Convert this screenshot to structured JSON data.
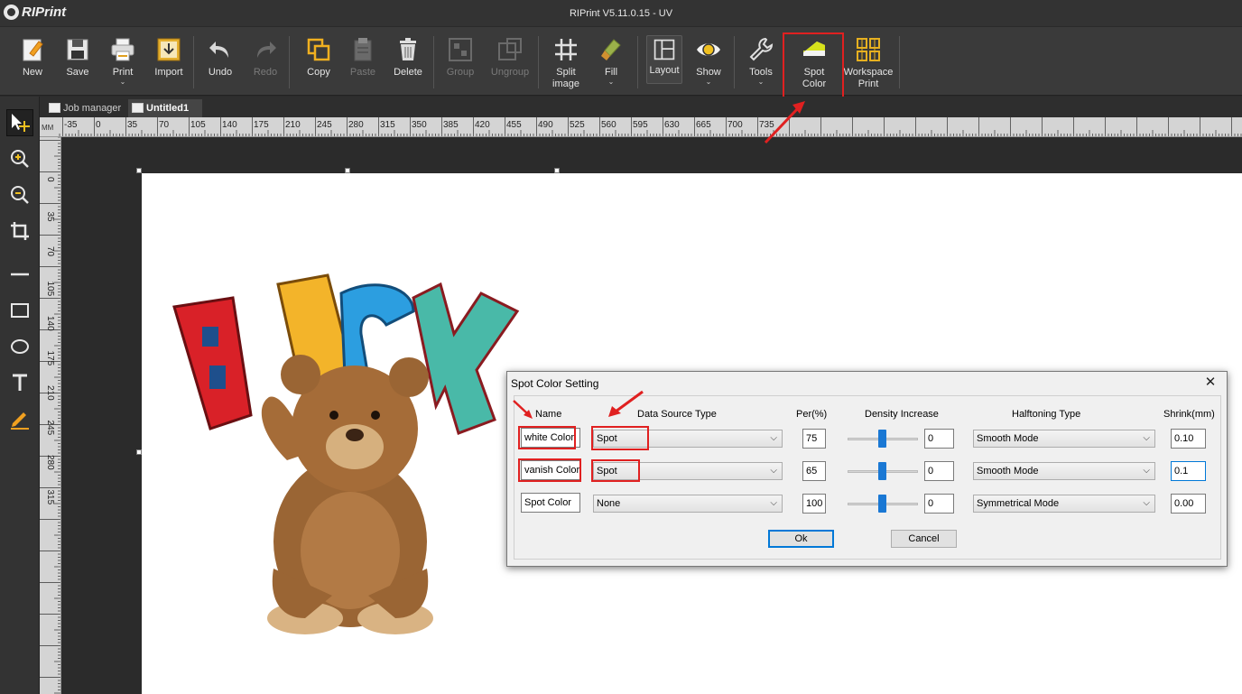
{
  "app": {
    "logo_text": "RIPrint",
    "title": "RIPrint V5.11.0.15 - UV"
  },
  "toolbar": {
    "new": "New",
    "save": "Save",
    "print": "Print",
    "import": "Import",
    "undo": "Undo",
    "redo": "Redo",
    "copy": "Copy",
    "paste": "Paste",
    "delete": "Delete",
    "group": "Group",
    "ungroup": "Ungroup",
    "split_image_1": "Split",
    "split_image_2": "image",
    "fill": "Fill",
    "layout": "Layout",
    "show": "Show",
    "tools": "Tools",
    "spot_color_1": "Spot",
    "spot_color_2": "Color",
    "workspace_print_1": "Workspace",
    "workspace_print_2": "Print"
  },
  "tabs": {
    "job_manager": "Job manager",
    "untitled": "Untitled1"
  },
  "ruler": {
    "unit": "MM",
    "h_ticks": [
      "-35",
      "0",
      "35",
      "70",
      "105",
      "140",
      "175",
      "210",
      "245",
      "280",
      "315",
      "350",
      "385",
      "420",
      "455",
      "490",
      "525",
      "560",
      "595",
      "630",
      "665",
      "700",
      "735"
    ],
    "v_ticks": [
      "0",
      "35",
      "70",
      "105",
      "140",
      "175",
      "210",
      "245",
      "280",
      "315"
    ]
  },
  "dialog": {
    "title": "Spot Color Setting",
    "headers": {
      "name": "Name",
      "data_source": "Data Source Type",
      "per": "Per(%)",
      "density": "Density Increase",
      "halftoning": "Halftoning Type",
      "shrink": "Shrink(mm)"
    },
    "rows": [
      {
        "name": "white Color",
        "source": "Spot",
        "per": "75",
        "density": "0",
        "halftone": "Smooth Mode",
        "shrink": "0.10"
      },
      {
        "name": "vanish Color",
        "source": "Spot",
        "per": "65",
        "density": "0",
        "halftone": "Smooth Mode",
        "shrink": "0.1"
      },
      {
        "name": "Spot Color",
        "source": "None",
        "per": "100",
        "density": "0",
        "halftone": "Symmetrical Mode",
        "shrink": "0.00"
      }
    ],
    "ok": "Ok",
    "cancel": "Cancel"
  },
  "colors": {
    "highlight": "#e02020",
    "accent": "#1a78d4",
    "background": "#2b2b2b"
  }
}
